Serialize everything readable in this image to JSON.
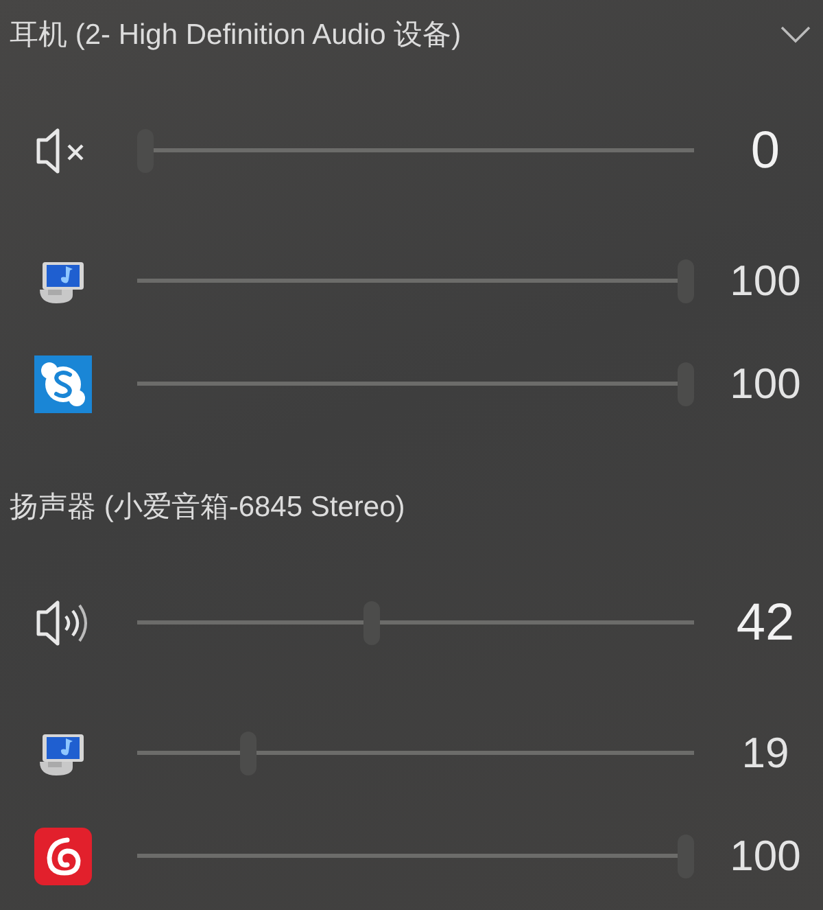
{
  "devices": [
    {
      "name": "耳机 (2- High Definition Audio 设备)",
      "expandable": true,
      "rows": [
        {
          "kind": "device",
          "muted": true,
          "level": 0,
          "reading": "0"
        },
        {
          "kind": "system",
          "level": 1,
          "reading": "100"
        },
        {
          "kind": "chat",
          "level": 1,
          "reading": "100"
        }
      ]
    },
    {
      "name": "扬声器 (小爱音箱-6845 Stereo)",
      "expandable": false,
      "rows": [
        {
          "kind": "device",
          "muted": false,
          "level": 0.42,
          "reading": "42"
        },
        {
          "kind": "system",
          "level": 0.19,
          "reading": "19"
        },
        {
          "kind": "music",
          "level": 1,
          "reading": "100"
        }
      ]
    }
  ]
}
